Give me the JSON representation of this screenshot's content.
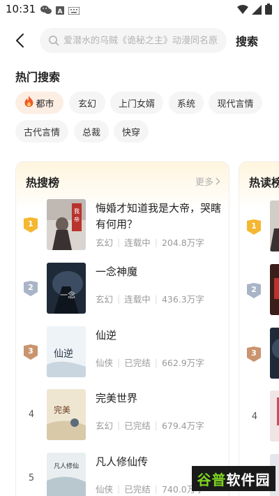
{
  "status_bar": {
    "time": "10:31",
    "left_icons": [
      "wechat-icon",
      "app-a-icon",
      "keyboard-icon"
    ],
    "right_icons": [
      "wifi-icon",
      "signal-icon",
      "battery-icon"
    ]
  },
  "search": {
    "placeholder": "爱潜水的乌贼《诡秘之主》动漫同名原",
    "button_label": "搜索"
  },
  "hot_search": {
    "title": "热门搜索",
    "tags": [
      "都市",
      "玄幻",
      "上门女婿",
      "系统",
      "现代言情",
      "古代言情",
      "总裁",
      "快穿"
    ]
  },
  "hot_list": {
    "title": "热搜榜",
    "more_label": "更多",
    "items": [
      {
        "rank": "1",
        "title": "悔婚才知道我是大帝，哭瞎有何用？",
        "genre": "玄幻",
        "status": "连载中",
        "words": "204.8万字"
      },
      {
        "rank": "2",
        "title": "一念神魔",
        "genre": "玄幻",
        "status": "连载中",
        "words": "436.3万字"
      },
      {
        "rank": "3",
        "title": "仙逆",
        "genre": "仙侠",
        "status": "已完结",
        "words": "662.9万字"
      },
      {
        "rank": "4",
        "title": "完美世界",
        "genre": "玄幻",
        "status": "已完结",
        "words": "679.4万字"
      },
      {
        "rank": "5",
        "title": "凡人修仙传",
        "genre": "仙侠",
        "status": "已完结",
        "words": "740.0万字"
      }
    ]
  },
  "hot_read_list": {
    "title": "热读榜",
    "ranks": [
      "1",
      "2",
      "3",
      "4"
    ]
  },
  "watermark": {
    "part1": "谷普",
    "part2": "软件园"
  },
  "colors": {
    "gold": "#f5b731",
    "silver": "#a9b4c6",
    "bronze": "#c9946e",
    "fire": "#f05a28"
  }
}
